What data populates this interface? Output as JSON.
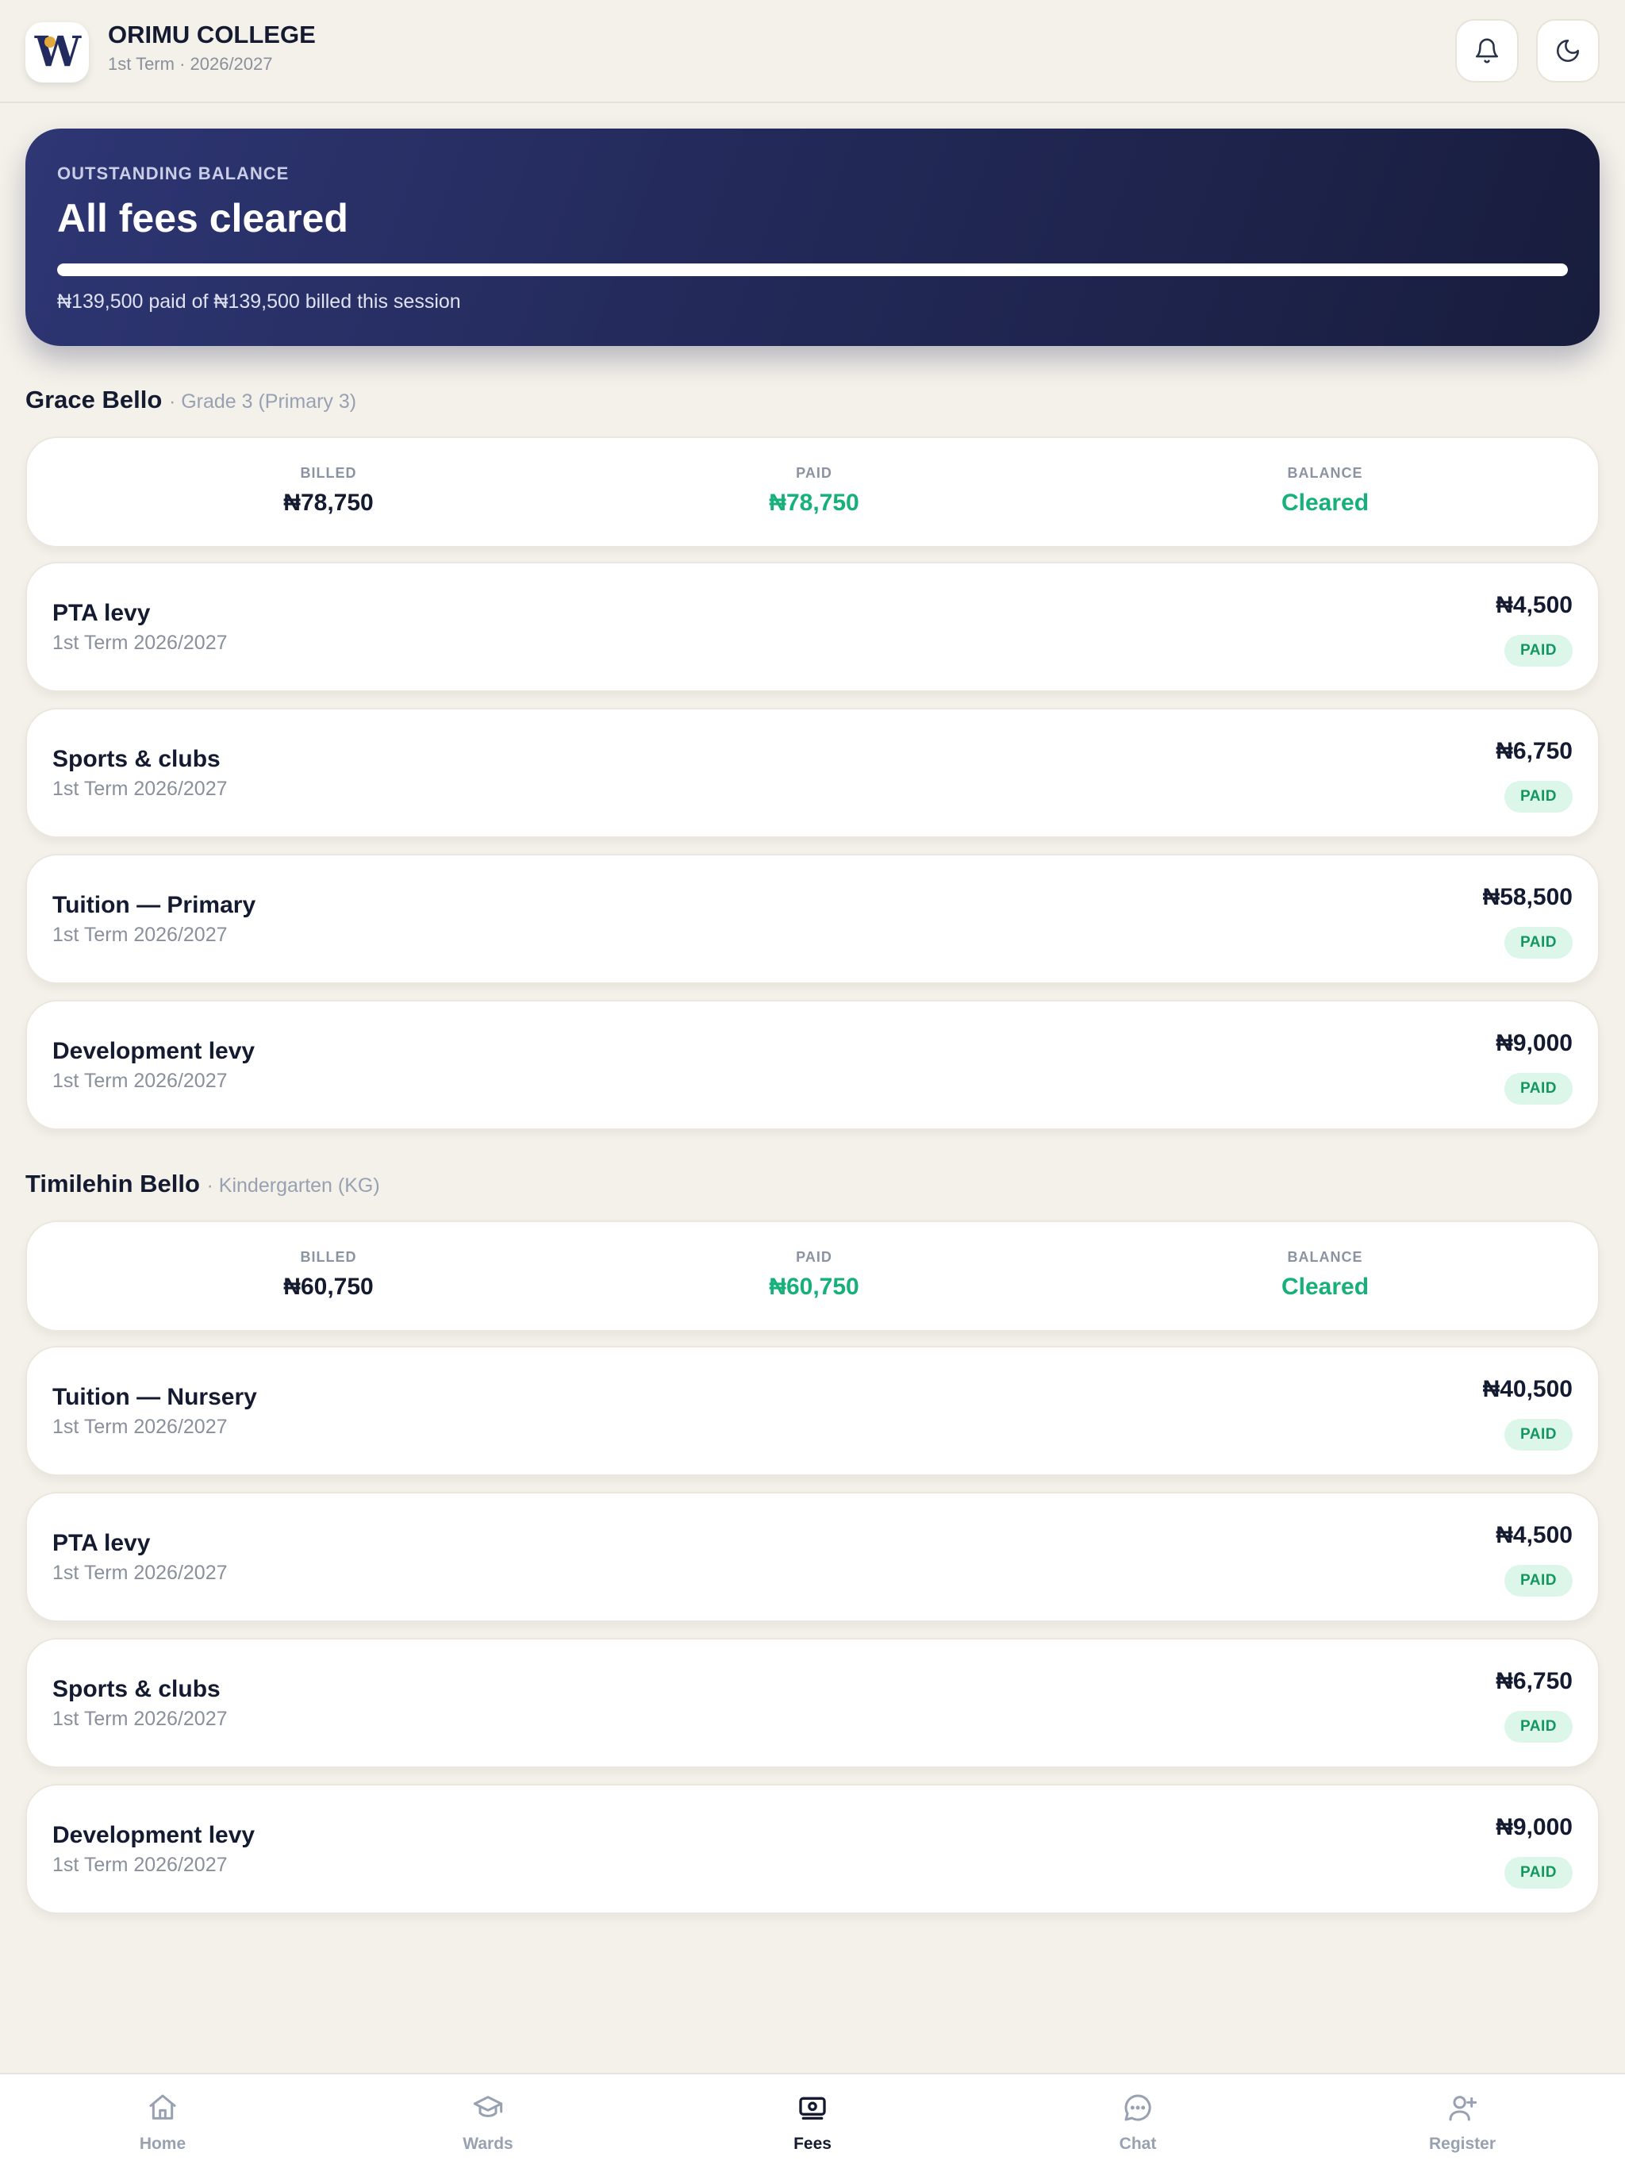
{
  "header": {
    "logo_letter": "W",
    "school_name": "ORIMU COLLEGE",
    "term": "1st Term · 2026/2027",
    "notifications_icon": "bell-icon",
    "theme_icon": "moon-icon"
  },
  "hero": {
    "label": "OUTSTANDING BALANCE",
    "title": "All fees cleared",
    "progress_percent": 100,
    "note": "₦139,500 paid of ₦139,500 billed this session"
  },
  "students": [
    {
      "name": "Grace Bello",
      "grade": "· Grade 3 (Primary 3)",
      "summary": {
        "billed_label": "BILLED",
        "billed": "₦78,750",
        "paid_label": "PAID",
        "paid": "₦78,750",
        "balance_label": "BALANCE",
        "balance": "Cleared"
      },
      "fees": [
        {
          "name": "PTA levy",
          "term": "1st Term 2026/2027",
          "amount": "₦4,500",
          "status": "PAID"
        },
        {
          "name": "Sports & clubs",
          "term": "1st Term 2026/2027",
          "amount": "₦6,750",
          "status": "PAID"
        },
        {
          "name": "Tuition — Primary",
          "term": "1st Term 2026/2027",
          "amount": "₦58,500",
          "status": "PAID"
        },
        {
          "name": "Development levy",
          "term": "1st Term 2026/2027",
          "amount": "₦9,000",
          "status": "PAID"
        }
      ]
    },
    {
      "name": "Timilehin Bello",
      "grade": "· Kindergarten (KG)",
      "summary": {
        "billed_label": "BILLED",
        "billed": "₦60,750",
        "paid_label": "PAID",
        "paid": "₦60,750",
        "balance_label": "BALANCE",
        "balance": "Cleared"
      },
      "fees": [
        {
          "name": "Tuition — Nursery",
          "term": "1st Term 2026/2027",
          "amount": "₦40,500",
          "status": "PAID"
        },
        {
          "name": "PTA levy",
          "term": "1st Term 2026/2027",
          "amount": "₦4,500",
          "status": "PAID"
        },
        {
          "name": "Sports & clubs",
          "term": "1st Term 2026/2027",
          "amount": "₦6,750",
          "status": "PAID"
        },
        {
          "name": "Development levy",
          "term": "1st Term 2026/2027",
          "amount": "₦9,000",
          "status": "PAID"
        }
      ]
    }
  ],
  "nav": {
    "active": "Fees",
    "items": [
      {
        "label": "Home",
        "icon": "home-icon"
      },
      {
        "label": "Wards",
        "icon": "graduation-cap-icon"
      },
      {
        "label": "Fees",
        "icon": "banknote-icon"
      },
      {
        "label": "Chat",
        "icon": "chat-bubble-icon"
      },
      {
        "label": "Register",
        "icon": "user-plus-icon"
      }
    ]
  },
  "colors": {
    "background": "#f4f1ea",
    "hero_start": "#2e3674",
    "hero_end": "#181d3d",
    "paid_green": "#16b07a",
    "badge_bg": "#dcf6ea",
    "text_dark": "#141a30",
    "muted": "#8a8f9c"
  }
}
